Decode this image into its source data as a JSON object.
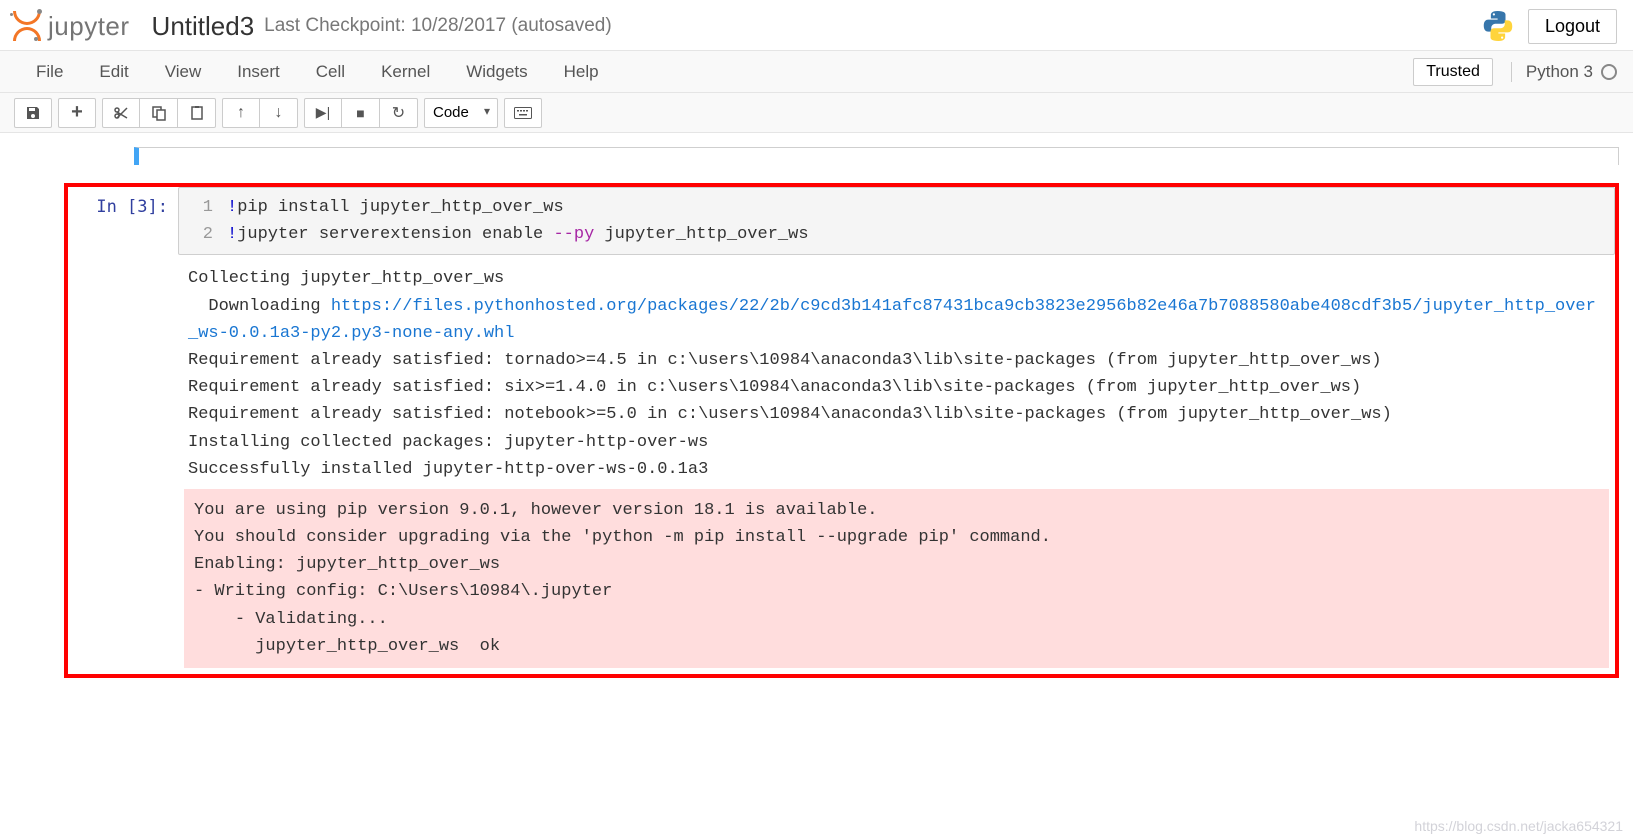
{
  "header": {
    "logo_text": "jupyter",
    "title": "Untitled3",
    "checkpoint": "Last Checkpoint: 10/28/2017 (autosaved)",
    "logout": "Logout"
  },
  "menu": {
    "items": [
      "File",
      "Edit",
      "View",
      "Insert",
      "Cell",
      "Kernel",
      "Widgets",
      "Help"
    ],
    "trusted": "Trusted",
    "kernel": "Python 3"
  },
  "toolbar": {
    "cell_type": "Code"
  },
  "cell": {
    "prompt_label": "In ",
    "prompt_num": "[3]:",
    "lines": [
      {
        "n": "1",
        "bang": "!",
        "cmd": "pip install jupyter_http_over_ws"
      },
      {
        "n": "2",
        "bang": "!",
        "cmd": "jupyter serverextension enable ",
        "flag": "--py",
        "rest": " jupyter_http_over_ws"
      }
    ]
  },
  "output": {
    "line1": "Collecting jupyter_http_over_ws",
    "line2_pre": "  Downloading ",
    "line2_url": "https://files.pythonhosted.org/packages/22/2b/c9cd3b141afc87431bca9cb3823e2956b82e46a7b7088580abe408cdf3b5/jupyter_http_over_ws-0.0.1a3-py2.py3-none-any.whl",
    "line3": "Requirement already satisfied: tornado>=4.5 in c:\\users\\10984\\anaconda3\\lib\\site-packages (from jupyter_http_over_ws)",
    "line4": "Requirement already satisfied: six>=1.4.0 in c:\\users\\10984\\anaconda3\\lib\\site-packages (from jupyter_http_over_ws)",
    "line5": "Requirement already satisfied: notebook>=5.0 in c:\\users\\10984\\anaconda3\\lib\\site-packages (from jupyter_http_over_ws)",
    "line6": "Installing collected packages: jupyter-http-over-ws",
    "line7": "Successfully installed jupyter-http-over-ws-0.0.1a3"
  },
  "stderr": {
    "l1": "You are using pip version 9.0.1, however version 18.1 is available.",
    "l2": "You should consider upgrading via the 'python -m pip install --upgrade pip' command.",
    "l3": "Enabling: jupyter_http_over_ws",
    "l4": "- Writing config: C:\\Users\\10984\\.jupyter",
    "l5": "    - Validating...",
    "l6": "      jupyter_http_over_ws  ok"
  },
  "watermark": "https://blog.csdn.net/jacka654321"
}
